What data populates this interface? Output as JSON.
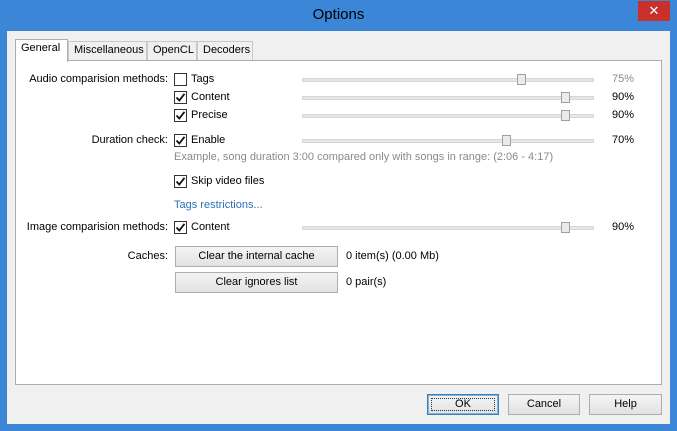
{
  "window": {
    "title": "Options",
    "close_glyph": "✕"
  },
  "tabs": [
    {
      "label": "General"
    },
    {
      "label": "Miscellaneous"
    },
    {
      "label": "OpenCL"
    },
    {
      "label": "Decoders"
    }
  ],
  "audio": {
    "label": "Audio comparision methods:",
    "items": [
      {
        "label": "Tags",
        "checked": false,
        "value_text": "75%",
        "value": 0.75
      },
      {
        "label": "Content",
        "checked": true,
        "value_text": "90%",
        "value": 0.9
      },
      {
        "label": "Precise",
        "checked": true,
        "value_text": "90%",
        "value": 0.9
      }
    ]
  },
  "duration": {
    "label": "Duration check:",
    "enable_label": "Enable",
    "checked": true,
    "value_text": "70%",
    "value": 0.7,
    "example": "Example, song duration 3:00 compared only with songs in range: (2:06 - 4:17)"
  },
  "skip_video": {
    "label": "Skip video files",
    "checked": true
  },
  "tags_restrictions": {
    "label": "Tags restrictions..."
  },
  "image": {
    "label": "Image comparision methods:",
    "content_label": "Content",
    "checked": true,
    "value_text": "90%",
    "value": 0.9
  },
  "caches": {
    "label": "Caches:",
    "clear_cache_label": "Clear the internal cache",
    "cache_info": "0 item(s) (0.00 Mb)",
    "clear_ignores_label": "Clear ignores list",
    "ignores_info": "0 pair(s)"
  },
  "footer": {
    "ok": "OK",
    "cancel": "Cancel",
    "help": "Help"
  },
  "colors": {
    "title_bar": "#3b86d6",
    "close": "#c7312a",
    "link": "#2f6fb7"
  }
}
